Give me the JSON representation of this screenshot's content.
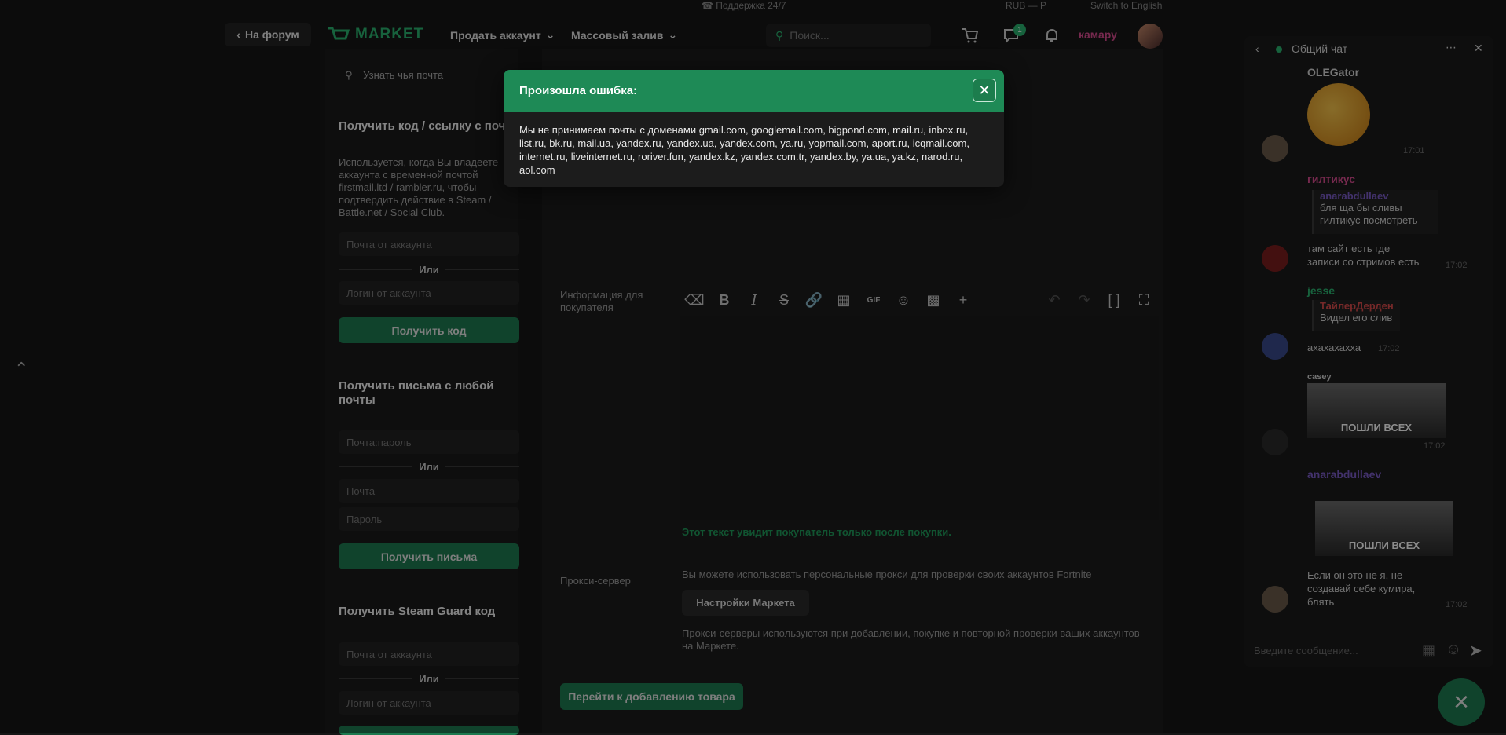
{
  "topstrip": {
    "support": "Поддержка 24/7",
    "currency": "RUB — Р",
    "lang_switch": "Switch to English"
  },
  "header": {
    "back_label": "На форум",
    "logo_text": "MARKET",
    "nav": [
      "Продать аккаунт",
      "Массовый залив"
    ],
    "search_placeholder": "Поиск...",
    "notif_count": "1",
    "username": "камару"
  },
  "left_panel": {
    "find_email_link": "Узнать чья почта",
    "code_title": "Получить код / ссылку с почты",
    "code_desc": "Используется, когда Вы владеете аккаунта с временной почтой firstmail.ltd / rambler.ru, чтобы подтвердить действие в Steam / Battle.net / Social Club.",
    "code_input1": "Почта от аккаунта",
    "or": "Или",
    "code_input2": "Логин от аккаунта",
    "code_btn": "Получить код",
    "letters_title": "Получить письма с любой почты",
    "letters_input1": "Почта:пароль",
    "letters_input2": "Почта",
    "letters_input3": "Пароль",
    "letters_btn": "Получить письма",
    "guard_title": "Получить Steam Guard код",
    "guard_input1": "Почта от аккаунта",
    "guard_input2": "Логин от аккаунта"
  },
  "form": {
    "buyer_info_label": "Информация для покупателя",
    "hint": "Этот текст увидит покупатель только после покупки.",
    "proxy_label": "Прокси-сервер",
    "proxy_text": "Вы можете использовать персональные прокси для проверки своих аккаунтов Fortnite",
    "settings_btn": "Настройки Маркета",
    "proxy_note": "Прокси-серверы используются при добавлении, покупке и повторной проверки ваших аккаунтов на Маркете.",
    "next_btn": "Перейти к добавлению товара"
  },
  "chat": {
    "title": "Общий чат",
    "messages": [
      {
        "name": "OLEGator",
        "time": "17:01",
        "color": "#2bb26f"
      },
      {
        "name": "гилтикус",
        "quote_name": "anarabdullaev",
        "quote_text": "бля ща бы сливы гилтикус посмотреть",
        "text": "там сайт есть где записи со стримов есть",
        "time": "17:02",
        "color": "#d84b8f"
      },
      {
        "name": "jesse",
        "quote_name": "ТайлерДерден",
        "quote_text": "Видел его слив",
        "text": "ахахахахха",
        "time": "17:02",
        "color": "#2bb26f"
      },
      {
        "name": "casey",
        "caption": "ПОШЛИ ВСЕХ",
        "time": "17:02",
        "color": "#cfcfcf"
      },
      {
        "name": "anarabdullaev",
        "caption": "ПОШЛИ ВСЕХ",
        "text": "Если он это не я, не создавай себе кумира, блять",
        "time": "17:02",
        "color": "#7b5cc7"
      }
    ],
    "input_placeholder": "Введите сообщение..."
  },
  "modal": {
    "title": "Произошла ошибка:",
    "body": "Мы не принимаем почты с доменами gmail.com, googlemail.com, bigpond.com, mail.ru, inbox.ru, list.ru, bk.ru, mail.ua, yandex.ru, yandex.ua, yandex.com, ya.ru, yopmail.com, aport.ru, icqmail.com, internet.ru, liveinternet.ru, roriver.fun, yandex.kz, yandex.com.tr, yandex.by, ya.ua, ya.kz, narod.ru, aol.com"
  },
  "colors": {
    "accent": "#1e8a56",
    "background": "#161616",
    "username": "#d84b8f"
  }
}
